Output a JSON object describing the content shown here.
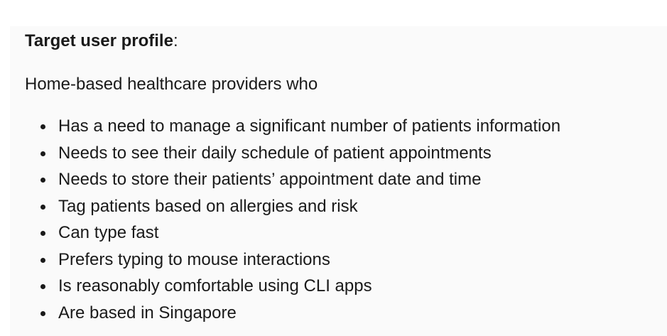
{
  "document": {
    "heading": {
      "title": "Target user profile",
      "suffix": ":"
    },
    "intro": "Home-based healthcare providers who",
    "items": [
      "Has a need to manage a significant number of patients information",
      "Needs to see their daily schedule of patient appointments",
      "Needs to store their patients’ appointment date and time",
      "Tag patients based on allergies and risk",
      "Can type fast",
      "Prefers typing to mouse interactions",
      "Is reasonably comfortable using CLI apps",
      "Are based in Singapore"
    ]
  }
}
